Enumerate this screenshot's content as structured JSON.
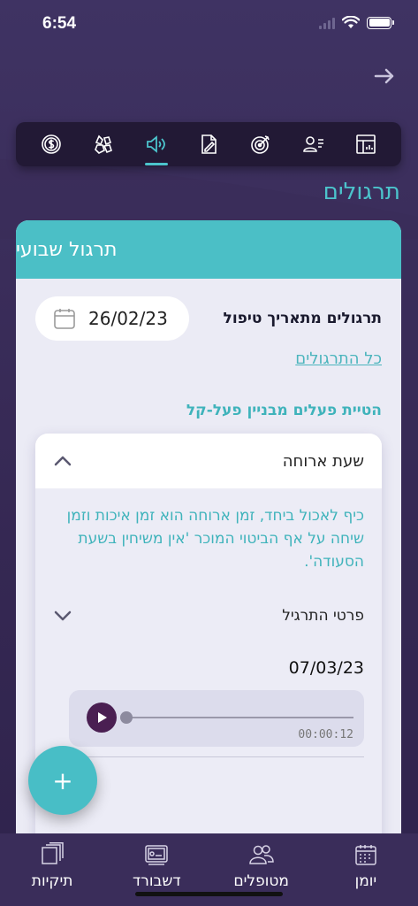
{
  "status": {
    "time": "6:54"
  },
  "page": {
    "title": "תרגולים"
  },
  "toolbar": {
    "items": [
      {
        "icon": "dashboard-chart-icon"
      },
      {
        "icon": "user-list-icon"
      },
      {
        "icon": "target-icon"
      },
      {
        "icon": "edit-document-icon"
      },
      {
        "icon": "sound-icon",
        "active": true
      },
      {
        "icon": "hands-icon"
      },
      {
        "icon": "dollar-icon"
      }
    ]
  },
  "card": {
    "header": "תרגול שבועי",
    "since_label": "תרגולים מתאריך טיפול",
    "date": "26/02/23",
    "all_link": "כל התרגולים",
    "subtitle": "הטיית פעלים מבניין פעל-קל",
    "exercise": {
      "title": "שעת ארוחה",
      "description": "כיף לאכול ביחד, זמן ארוחה הוא זמן איכות וזמן שיחה על אף הביטוי המוכר 'אין משיחין בשעת הסעודה'.",
      "details_label": "פרטי התרגיל",
      "date": "07/03/23",
      "audio_time": "00:00:12",
      "audio_progress": 0
    }
  },
  "fab": {
    "label": "+"
  },
  "bottom_nav": {
    "items": [
      {
        "label": "יומן",
        "icon": "calendar-icon"
      },
      {
        "label": "מטופלים",
        "icon": "patients-icon"
      },
      {
        "label": "דשבורד",
        "icon": "dashboard-icon"
      },
      {
        "label": "תיקיות",
        "icon": "folders-icon"
      }
    ]
  },
  "colors": {
    "accent": "#4bbfc6",
    "background": "#3c2f5c",
    "toolbar": "#221935"
  }
}
